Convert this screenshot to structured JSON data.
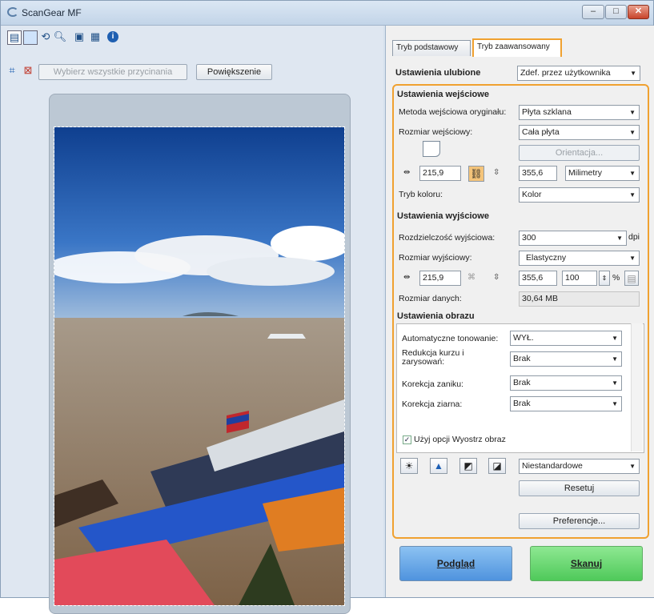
{
  "window": {
    "title": "ScanGear MF",
    "controls": {
      "minimize": "–",
      "maximize": "□",
      "close": "✕"
    }
  },
  "toolbar": {
    "icons": [
      "thumbnail-icon",
      "select-frame-icon",
      "rotate-icon",
      "zoom-icon",
      "copy-icon",
      "paste-icon",
      "info-icon"
    ],
    "select_all_label": "Wybierz wszystkie przycinania",
    "zoom_label": "Powiększenie"
  },
  "tabs": {
    "basic": "Tryb podstawowy",
    "advanced": "Tryb zaawansowany"
  },
  "favorites": {
    "label": "Ustawienia ulubione",
    "value": "Zdef. przez użytkownika"
  },
  "input_settings": {
    "header": "Ustawienia wejściowe",
    "source_label": "Metoda wejściowa oryginału:",
    "source_value": "Płyta szklana",
    "size_label": "Rozmiar wejściowy:",
    "size_value": "Cała płyta",
    "orientation_label": "Orientacja...",
    "width": "215,9",
    "height": "355,6",
    "unit": "Milimetry",
    "color_mode_label": "Tryb koloru:",
    "color_mode_value": "Kolor"
  },
  "output_settings": {
    "header": "Ustawienia wyjściowe",
    "resolution_label": "Rozdzielczość wyjściowa:",
    "resolution_value": "300",
    "resolution_unit": "dpi",
    "size_label": "Rozmiar wyjściowy:",
    "size_value": "Elastyczny",
    "width": "215,9",
    "height": "355,6",
    "scale": "100",
    "scale_unit": "%",
    "data_size_label": "Rozmiar danych:",
    "data_size_value": "30,64 MB"
  },
  "image_settings": {
    "header": "Ustawienia obrazu",
    "auto_tone_label": "Automatyczne tonowanie:",
    "auto_tone_value": "WYŁ.",
    "dust_label": "Redukcja kurzu i zarysowań:",
    "dust_value": "Brak",
    "fading_label": "Korekcja zaniku:",
    "fading_value": "Brak",
    "grain_label": "Korekcja ziarna:",
    "grain_value": "Brak",
    "unsharp_label": "Użyj opcji Wyostrz obraz"
  },
  "color_adjust": {
    "preset": "Niestandardowe",
    "reset": "Resetuj"
  },
  "preferences_label": "Preferencje...",
  "actions": {
    "preview": "Podgląd",
    "scan": "Skanuj"
  },
  "colors": {
    "accent": "#f0a130",
    "preview_btn": "#5aa2e6",
    "scan_btn": "#5fd36a"
  }
}
